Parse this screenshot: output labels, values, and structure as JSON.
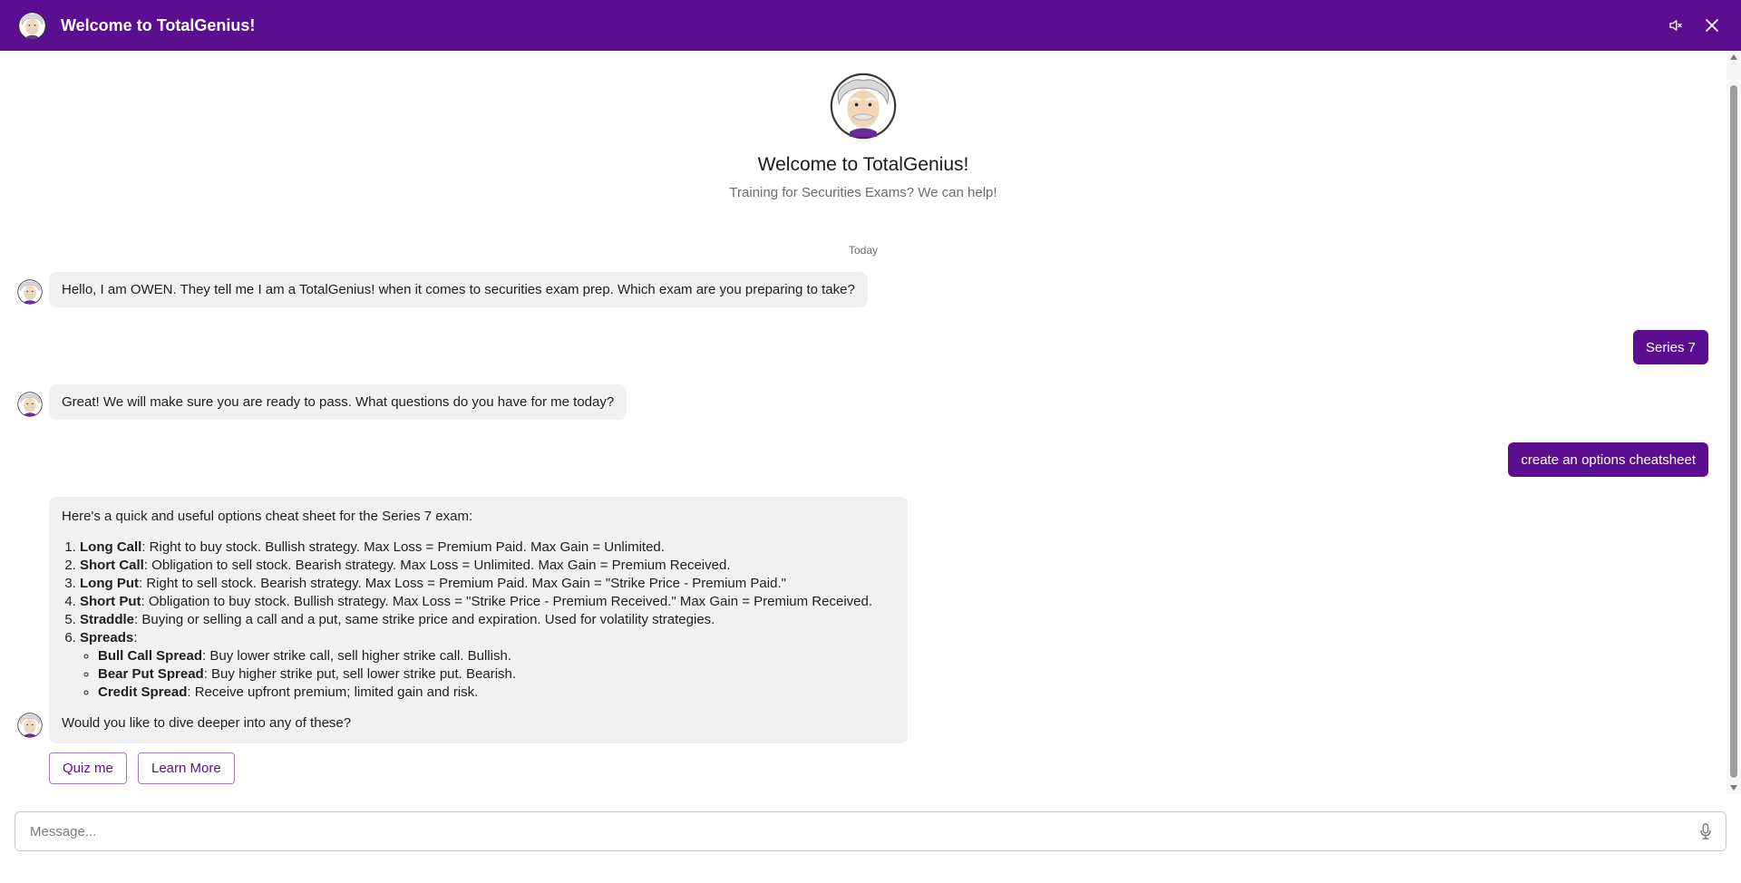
{
  "header": {
    "title": "Welcome to TotalGenius!",
    "brand_color": "#5c0e91",
    "mute_icon": "speaker-muted-icon",
    "close_icon": "close-icon"
  },
  "intro": {
    "title": "Welcome to TotalGenius!",
    "subtitle": "Training for Securities Exams? We can help!"
  },
  "day_label": "Today",
  "messages": {
    "bot1": "Hello, I am OWEN.  They tell me I am a TotalGenius! when it comes to securities exam prep.  Which exam are you preparing to take?",
    "user1": "Series 7",
    "bot2": "Great!  We will make sure you are ready to pass.  What questions do you have for me today?",
    "user2": "create an options cheatsheet",
    "bot3": {
      "intro": "Here's a quick and useful options cheat sheet for the Series 7 exam:",
      "items": [
        {
          "term": "Long Call",
          "text": ": Right to buy stock. Bullish strategy. Max Loss = Premium Paid. Max Gain = Unlimited."
        },
        {
          "term": "Short Call",
          "text": ": Obligation to sell stock. Bearish strategy. Max Loss = Unlimited. Max Gain = Premium Received."
        },
        {
          "term": "Long Put",
          "text": ": Right to sell stock. Bearish strategy. Max Loss = Premium Paid. Max Gain = \"Strike Price - Premium Paid.\""
        },
        {
          "term": "Short Put",
          "text": ": Obligation to buy stock. Bullish strategy. Max Loss = \"Strike Price - Premium Received.\" Max Gain = Premium Received."
        },
        {
          "term": "Straddle",
          "text": ": Buying or selling a call and a put, same strike price and expiration. Used for volatility strategies."
        },
        {
          "term": "Spreads",
          "text": ":"
        }
      ],
      "sub_items": [
        {
          "term": "Bull Call Spread",
          "text": ": Buy lower strike call, sell higher strike call. Bullish."
        },
        {
          "term": "Bear Put Spread",
          "text": ": Buy higher strike put, sell lower strike put. Bearish."
        },
        {
          "term": "Credit Spread",
          "text": ": Receive upfront premium; limited gain and risk."
        }
      ],
      "closing": "Would you like to dive deeper into any of these?"
    }
  },
  "quick_replies": {
    "quiz": "Quiz me",
    "learn": "Learn More"
  },
  "composer": {
    "placeholder": "Message...",
    "mic_icon": "microphone-icon"
  }
}
